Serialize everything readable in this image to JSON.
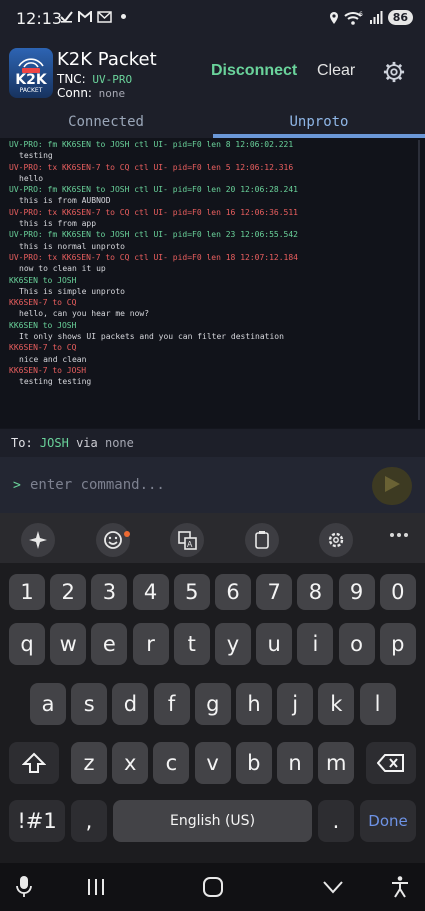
{
  "status_bar": {
    "time": "12:13",
    "battery": "86",
    "left_icons": [
      "check-icon",
      "gmail-icon",
      "mail-icon",
      "dot-icon"
    ],
    "right_icons": [
      "location-icon",
      "wifi-icon",
      "signal-icon",
      "battery-icon"
    ]
  },
  "header": {
    "app_title": "K2K Packet",
    "logo_text": "K2K",
    "logo_sub": "PACKET",
    "tnc_label": "TNC:",
    "tnc_value": "UV-PRO",
    "conn_label": "Conn:",
    "conn_value": "none",
    "disconnect_label": "Disconnect",
    "clear_label": "Clear",
    "colors": {
      "accent_green": "#6ad39b",
      "tab_blue": "#6b98d8"
    }
  },
  "tabs": [
    {
      "label": "Connected"
    },
    {
      "label": "Unproto",
      "active": true
    }
  ],
  "log": [
    {
      "kind": "green",
      "text": "UV-PRO: fm KK6SEN to JOSH ctl UI- pid=F0 len 8 12:06:02.221"
    },
    {
      "kind": "text",
      "text": "testing"
    },
    {
      "kind": "red",
      "text": "UV-PRO: tx KK6SEN-7 to CQ ctl UI- pid=F0 len 5 12:06:12.316"
    },
    {
      "kind": "text",
      "text": "hello"
    },
    {
      "kind": "green",
      "text": "UV-PRO: fm KK6SEN to JOSH ctl UI- pid=F0 len 20 12:06:28.241"
    },
    {
      "kind": "text",
      "text": "this is from AUBNOD"
    },
    {
      "kind": "red",
      "text": "UV-PRO: tx KK6SEN-7 to CQ ctl UI- pid=F0 len 16 12:06:36.511"
    },
    {
      "kind": "text",
      "text": "this is from app"
    },
    {
      "kind": "green",
      "text": "UV-PRO: fm KK6SEN to JOSH ctl UI- pid=F0 len 23 12:06:55.542"
    },
    {
      "kind": "text",
      "text": "this is normal unproto"
    },
    {
      "kind": "red",
      "text": "UV-PRO: tx KK6SEN-7 to CQ ctl UI- pid=F0 len 18 12:07:12.184"
    },
    {
      "kind": "text",
      "text": "now to clean it up"
    },
    {
      "kind": "green",
      "text": "KK6SEN to JOSH"
    },
    {
      "kind": "text",
      "text": "This is simple unproto"
    },
    {
      "kind": "red",
      "text": "KK6SEN-7 to CQ"
    },
    {
      "kind": "text",
      "text": "hello, can you hear me now?"
    },
    {
      "kind": "green",
      "text": "KK6SEN to JOSH"
    },
    {
      "kind": "text",
      "text": "It only shows UI packets and you can filter destination"
    },
    {
      "kind": "red",
      "text": "KK6SEN-7 to CQ"
    },
    {
      "kind": "text",
      "text": "nice and clean"
    },
    {
      "kind": "red",
      "text": "KK6SEN-7 to JOSH"
    },
    {
      "kind": "text",
      "text": "testing testing"
    }
  ],
  "to_bar": {
    "label": "To:",
    "dest": "JOSH",
    "via_label": "via",
    "via_value": "none"
  },
  "command": {
    "prompt": ">",
    "placeholder": "enter command...",
    "value": ""
  },
  "keyboard": {
    "toolbar_icons": [
      "sparkle-icon",
      "emoji-icon",
      "translate-icon",
      "clipboard-icon",
      "settings-icon",
      "more-icon"
    ],
    "row_numbers": [
      "1",
      "2",
      "3",
      "4",
      "5",
      "6",
      "7",
      "8",
      "9",
      "0"
    ],
    "row1": [
      "q",
      "w",
      "e",
      "r",
      "t",
      "y",
      "u",
      "i",
      "o",
      "p"
    ],
    "row2": [
      "a",
      "s",
      "d",
      "f",
      "g",
      "h",
      "j",
      "k",
      "l"
    ],
    "row3": [
      "z",
      "x",
      "c",
      "v",
      "b",
      "n",
      "m"
    ],
    "symbols_label": "!#1",
    "comma_label": ",",
    "space_label": "English (US)",
    "period_label": ".",
    "done_label": "Done"
  },
  "nav_bar": {
    "icons": [
      "mic-icon",
      "recents-icon",
      "home-icon",
      "back-icon",
      "accessibility-icon"
    ]
  }
}
